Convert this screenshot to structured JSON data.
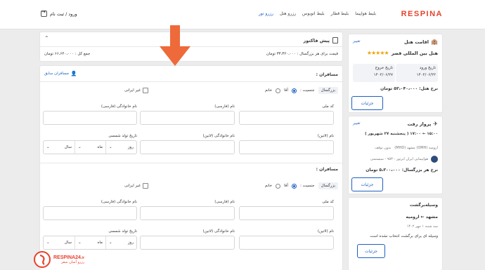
{
  "header": {
    "logo": "RESPINA",
    "nav": [
      "بلیط هواپیما",
      "بلیط قطار",
      "بلیط اتوبوس",
      "رزرو هتل",
      "رزرو تور"
    ],
    "active_nav": "رزرو تور",
    "login": "ورود / ثبت نام"
  },
  "hotel": {
    "title": "اقامت هتل",
    "change": "تغییر",
    "name": "هتل بین المللی قصر",
    "stars": "★★★★★",
    "checkin_label": "تاریخ ورود",
    "checkin_date": "۱۴۰۲/۰۶/۲۲",
    "checkout_label": "تاریخ خروج",
    "checkout_date": "۱۴۰۲/۰۶/۲۷",
    "adult_price": "نرخ هتل: ۵۳،۰۴۰،۰۰۰ تومان",
    "details": "جزئیات"
  },
  "flight_out": {
    "title": "پرواز رفت",
    "change": "تغییر",
    "times": "۱۵:۰۰ ← ۱۷:۰۰ ( پنجشنبه ۲۷ شهریور )",
    "route": "ارومیه (OMH) مشهد (MHD)",
    "stops": "بدون توقف",
    "airline": "هواپیمایی ایران ایرتور - ۹۵۳ - سیستمی",
    "adult_price": "نرخ هر بزرگسال: ۵،۳۰۰،۰۰۰ تومان",
    "details": "جزئیات"
  },
  "transport_return": {
    "title": "وسیله‌برگشت",
    "route": "مشهد ← ارومیه",
    "date": "سه شنبه ۱ مهر ۱۴۰۲",
    "note": "وسیله ای برای برگشت انتخاب نشده است",
    "button": "جزئیات"
  },
  "invoice": {
    "title": "پیش فاکتور",
    "per_adult": "قیمت برای هر بزرگسال : ۳۳،۳۲۰،۰۰۰ تومان",
    "total": "جمع کل : ۶۶،۶۴۰،۰۰۰ تومان"
  },
  "passengers": {
    "previous": "مسافران سابق",
    "section_title": "مسافران :",
    "age_badge": "بزرگسال",
    "gender_label": "جنسیت :",
    "male": "آقا",
    "female": "خانم",
    "non_iranian": "غیر ایرانی",
    "national_code": "کد ملی",
    "first_name_fa": "نام (فارسی)",
    "last_name_fa": "نام خانوادگی (فارسی)",
    "first_name_en": "نام (لاتین)",
    "last_name_en": "نام خانوادگی (لاتین)",
    "birth_date": "تاریخ تولد شمسی",
    "day": "روز",
    "month": "ماه",
    "year": "سال"
  },
  "watermark": {
    "brand": "RESPINA24",
    "tld": ".ir",
    "slogan": "رزرو آسان سفر"
  },
  "colors": {
    "brand": "#e8412b",
    "accent": "#1e5fbf",
    "arrow": "#ee6a3a",
    "stars": "#f0a30a"
  }
}
